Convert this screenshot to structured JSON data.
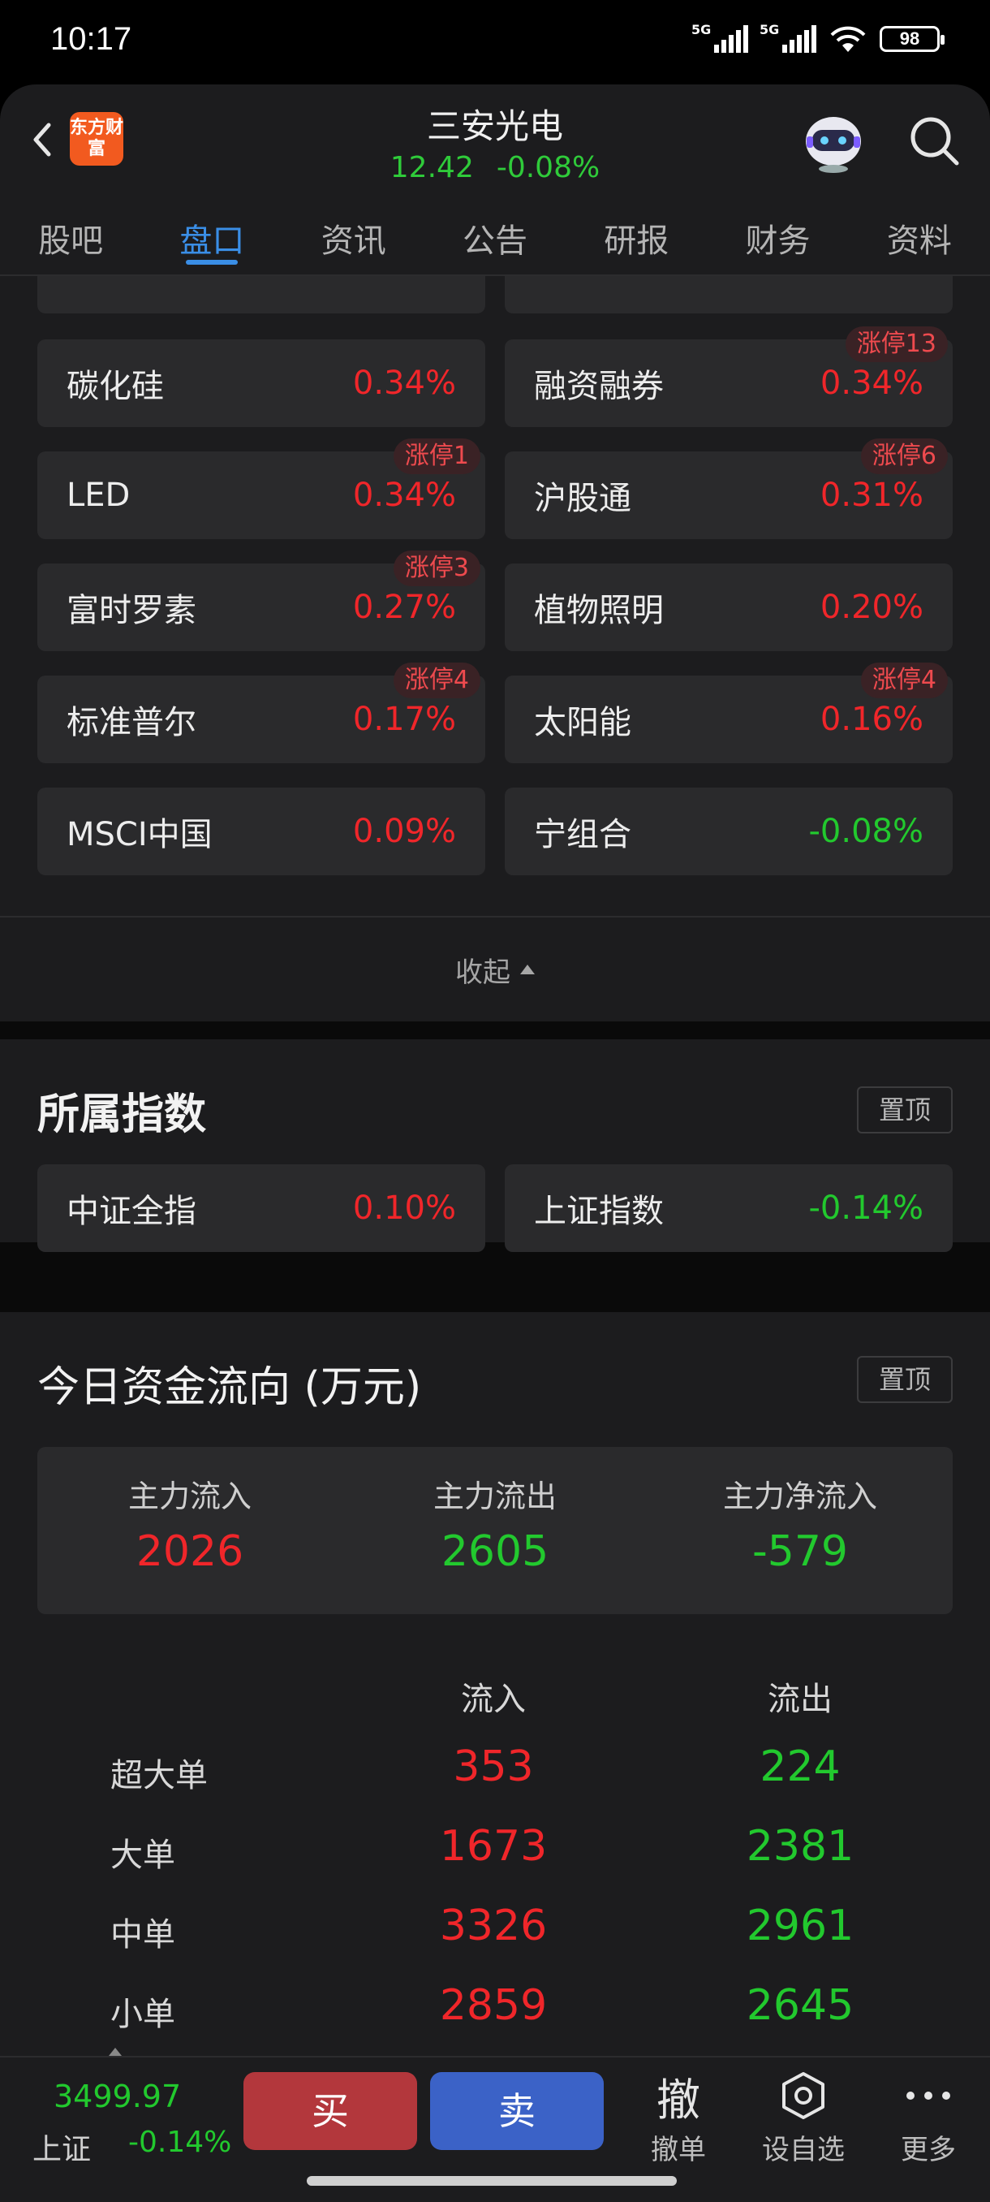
{
  "status_bar": {
    "time": "10:17",
    "net1": "5G",
    "net2": "5G",
    "battery": "98"
  },
  "header": {
    "logo_text": "东方财富",
    "stock_name": "三安光电",
    "price": "12.42",
    "change": "-0.08%"
  },
  "tabs": [
    "股吧",
    "盘口",
    "资讯",
    "公告",
    "研报",
    "财务",
    "资料"
  ],
  "concepts": {
    "cells": [
      {
        "name": "碳化硅",
        "pct": "0.34%",
        "tag": ""
      },
      {
        "name": "融资融券",
        "pct": "0.34%",
        "tag": "涨停13"
      },
      {
        "name": "LED",
        "pct": "0.34%",
        "tag": "涨停1"
      },
      {
        "name": "沪股通",
        "pct": "0.31%",
        "tag": "涨停6"
      },
      {
        "name": "富时罗素",
        "pct": "0.27%",
        "tag": "涨停3"
      },
      {
        "name": "植物照明",
        "pct": "0.20%",
        "tag": ""
      },
      {
        "name": "标准普尔",
        "pct": "0.17%",
        "tag": "涨停4"
      },
      {
        "name": "太阳能",
        "pct": "0.16%",
        "tag": "涨停4"
      },
      {
        "name": "MSCI中国",
        "pct": "0.09%",
        "tag": ""
      },
      {
        "name": "宁组合",
        "pct": "-0.08%",
        "tag": ""
      }
    ],
    "collapse_label": "收起"
  },
  "indices": {
    "title": "所属指数",
    "pin_label": "置顶",
    "items": [
      {
        "name": "中证全指",
        "pct": "0.10%"
      },
      {
        "name": "上证指数",
        "pct": "-0.14%"
      }
    ]
  },
  "fund_flow": {
    "title": "今日资金流向 (万元)",
    "pin_label": "置顶",
    "summary": [
      {
        "label": "主力流入",
        "value": "2026"
      },
      {
        "label": "主力流出",
        "value": "2605"
      },
      {
        "label": "主力净流入",
        "value": "-579"
      }
    ],
    "col_in": "流入",
    "col_out": "流出",
    "rows": [
      {
        "label": "超大单",
        "in": "353",
        "out": "224"
      },
      {
        "label": "大单",
        "in": "1673",
        "out": "2381"
      },
      {
        "label": "中单",
        "in": "3326",
        "out": "2961"
      },
      {
        "label": "小单",
        "in": "2859",
        "out": "2645"
      }
    ]
  },
  "bottom": {
    "index_value": "3499.97",
    "index_name": "上证",
    "index_change": "-0.14%",
    "buy": "买",
    "sell": "卖",
    "cancel_icon": "撤",
    "cancel_label": "撤单",
    "watch_label": "设自选",
    "more_label": "更多"
  },
  "colors": {
    "up": "#f0262a",
    "down": "#22c92e",
    "accent": "#3a8ee6",
    "buy": "#b3373c",
    "sell": "#3b62c7"
  }
}
